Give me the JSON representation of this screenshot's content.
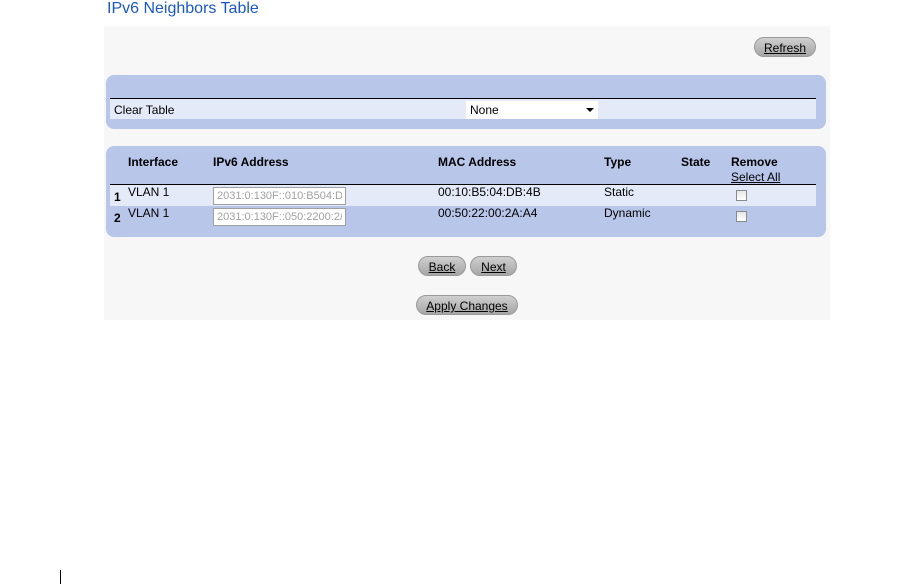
{
  "page": {
    "title": "IPv6 Neighbors Table"
  },
  "toolbar": {
    "refresh_label": "Refresh"
  },
  "clear_table": {
    "label": "Clear Table",
    "selected": "None"
  },
  "table": {
    "headers": {
      "interface": "Interface",
      "ipv6_address": "IPv6 Address",
      "mac_address": "MAC Address",
      "type": "Type",
      "state": "State",
      "remove": "Remove"
    },
    "select_all_label": "Select All",
    "rows": [
      {
        "num": "1",
        "interface": "VLAN 1",
        "ipv6": "2031:0:130F::010:B504:D",
        "mac": "00:10:B5:04:DB:4B",
        "type": "Static",
        "state": "",
        "remove": false
      },
      {
        "num": "2",
        "interface": "VLAN 1",
        "ipv6": "2031:0:130F::050:2200:2/",
        "mac": "00:50:22:00:2A:A4",
        "type": "Dynamic",
        "state": "",
        "remove": false
      }
    ]
  },
  "nav": {
    "back_label": "Back",
    "next_label": "Next"
  },
  "actions": {
    "apply_label": "Apply Changes"
  },
  "colors": {
    "title": "#1a58c6",
    "panel": "#b8c6ea",
    "row_light": "#e4eaf8"
  }
}
